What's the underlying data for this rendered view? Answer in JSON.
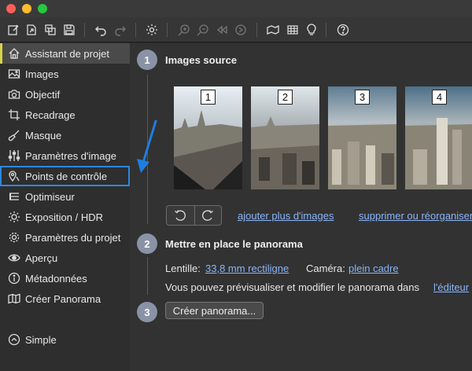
{
  "toolbar": {
    "icons": [
      "new-project-icon",
      "open-project-icon",
      "open-images-icon",
      "save-icon",
      "undo-icon",
      "redo-icon",
      "settings-icon",
      "zoom-in-icon",
      "zoom-out-icon",
      "rewind-icon",
      "stitch-panorama-icon",
      "grid-icon",
      "lightbulb-icon",
      "help-icon"
    ]
  },
  "sidebar": {
    "items": [
      {
        "label": "Assistant de projet",
        "icon": "home-icon"
      },
      {
        "label": "Images",
        "icon": "image-icon"
      },
      {
        "label": "Objectif",
        "icon": "camera-icon"
      },
      {
        "label": "Recadrage",
        "icon": "crop-icon"
      },
      {
        "label": "Masque",
        "icon": "brush-icon"
      },
      {
        "label": "Paramètres d'image",
        "icon": "sliders-icon"
      },
      {
        "label": "Points de contrôle",
        "icon": "map-pin-icon"
      },
      {
        "label": "Optimiseur",
        "icon": "optimizer-icon"
      },
      {
        "label": "Exposition / HDR",
        "icon": "sun-icon"
      },
      {
        "label": "Paramètres du projet",
        "icon": "gear-icon"
      },
      {
        "label": "Aperçu",
        "icon": "eye-icon"
      },
      {
        "label": "Métadonnées",
        "icon": "info-icon"
      },
      {
        "label": "Créer Panorama",
        "icon": "panorama-icon"
      }
    ],
    "simple_label": "Simple"
  },
  "steps": {
    "s1": {
      "num": "1",
      "title": "Images source"
    },
    "s2": {
      "num": "2",
      "title": "Mettre en place le panorama"
    },
    "s3": {
      "num": "3",
      "title": ""
    }
  },
  "thumbnails": [
    {
      "num": "1"
    },
    {
      "num": "2"
    },
    {
      "num": "3"
    },
    {
      "num": "4"
    }
  ],
  "actions": {
    "add_images": "ajouter plus d'images",
    "remove_images": "supprimer ou réorganiser"
  },
  "setup": {
    "lens_label": "Lentille:",
    "lens_value": "33,8 mm rectiligne",
    "camera_label": "Caméra:",
    "camera_value": "plein cadre",
    "preview_text": "Vous pouvez prévisualiser et modifier le panorama dans",
    "editor_link": "l'éditeur"
  },
  "create_button": "Créer panorama...",
  "colors": {
    "accent_active": "#d7d34a",
    "highlight_outline": "#2c87dd",
    "link": "#8ab4f8",
    "badge": "#8a93a6"
  }
}
